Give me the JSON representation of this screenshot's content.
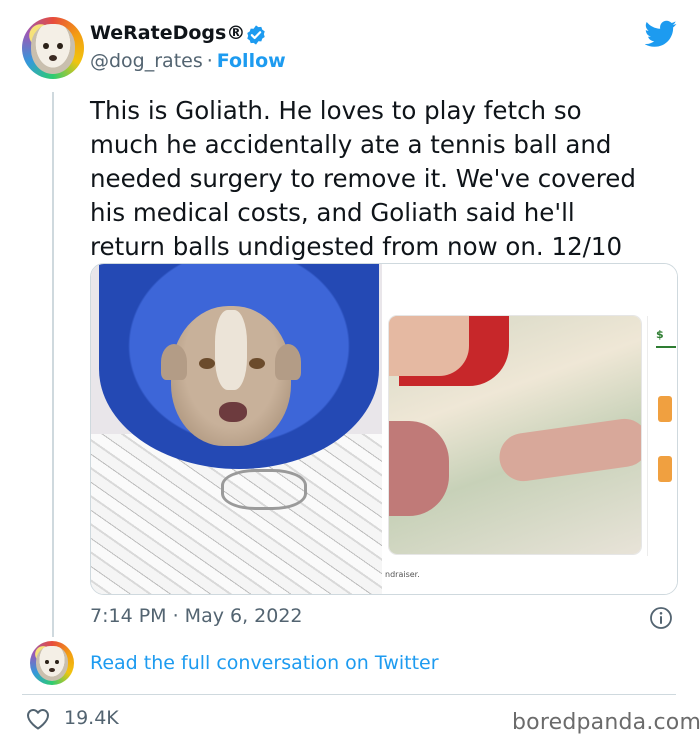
{
  "author": {
    "display_name": "WeRateDogs®",
    "handle": "@dog_rates",
    "separator": "·",
    "follow_label": "Follow"
  },
  "tweet": {
    "text": "This is Goliath. He loves to play fetch so\nmuch he accidentally ate a tennis ball and\nneeded surgery to remove it. We've covered\nhis medical costs, and Goliath said he'll\nreturn balls undigested from now on. 12/10",
    "timestamp": "7:14 PM · May 6, 2022",
    "media": {
      "right_caption": "ndraiser."
    }
  },
  "footer": {
    "read_more": "Read the full conversation on Twitter",
    "likes": "19.4K"
  },
  "watermark": "boredpanda.com",
  "colors": {
    "accent": "#1d9bf0",
    "text": "#0f1419",
    "muted": "#536471",
    "border": "#cfd9de"
  },
  "icons": [
    "verified-badge-icon",
    "twitter-bird-icon",
    "info-icon",
    "heart-icon"
  ]
}
